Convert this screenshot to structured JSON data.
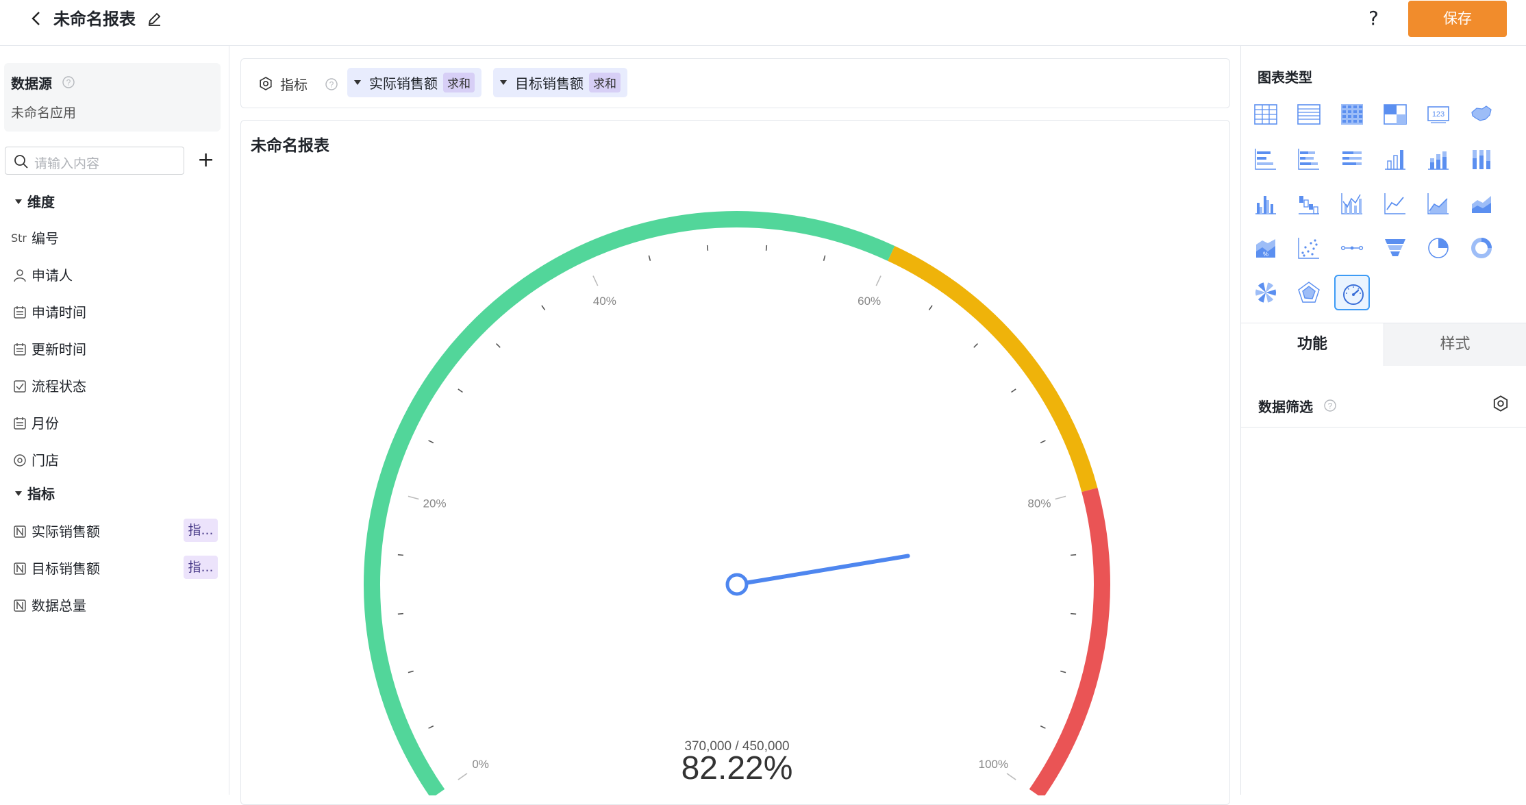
{
  "header": {
    "title": "未命名报表",
    "help": "?",
    "save_label": "保存"
  },
  "sidebar": {
    "datasource_title": "数据源",
    "datasource_name": "未命名应用",
    "search_placeholder": "请输入内容",
    "add": "+",
    "dimension_group": "维度",
    "dimensions": [
      {
        "icon": "Str",
        "label": "编号"
      },
      {
        "icon": "person-icon",
        "label": "申请人"
      },
      {
        "icon": "calendar-icon",
        "label": "申请时间"
      },
      {
        "icon": "calendar-icon",
        "label": "更新时间"
      },
      {
        "icon": "checkbox-icon",
        "label": "流程状态"
      },
      {
        "icon": "calendar-icon",
        "label": "月份"
      },
      {
        "icon": "target-icon",
        "label": "门店"
      }
    ],
    "metric_group": "指标",
    "metrics": [
      {
        "label": "实际销售额",
        "tag": "指..."
      },
      {
        "label": "目标销售额",
        "tag": "指..."
      },
      {
        "label": "数据总量",
        "tag": ""
      }
    ]
  },
  "toolbar": {
    "label": "指标",
    "pills": [
      {
        "label": "实际销售额",
        "agg": "求和"
      },
      {
        "label": "目标销售额",
        "agg": "求和"
      }
    ]
  },
  "chart": {
    "title": "未命名报表"
  },
  "chart_data": {
    "type": "gauge",
    "value": 370000,
    "target": 450000,
    "ratio_text": "370,000 / 450,000",
    "percent_text": "82.22%",
    "percent": 82.22,
    "tick_labels": [
      "0%",
      "20%",
      "40%",
      "60%",
      "80%",
      "100%"
    ],
    "bands": [
      {
        "from": 0,
        "to": 0.6,
        "color": "#52d69a"
      },
      {
        "from": 0.6,
        "to": 0.8,
        "color": "#efb30a"
      },
      {
        "from": 0.8,
        "to": 1.0,
        "color": "#ea5455"
      }
    ],
    "pointer_color": "#4e86ef"
  },
  "right": {
    "chart_types_title": "图表类型",
    "tab_function": "功能",
    "tab_style": "样式",
    "filter_label": "数据筛选",
    "chart_type_icons": [
      "table-icon",
      "list-table-icon",
      "grid-table-icon",
      "pivot-table-icon",
      "number-card-icon",
      "map-icon",
      "bar-horizontal-icon",
      "stacked-bar-horizontal-icon",
      "percent-bar-horizontal-icon",
      "column-icon",
      "stacked-column-icon",
      "percent-column-icon",
      "grouped-column-icon",
      "waterfall-icon",
      "column-line-icon",
      "line-icon",
      "area-line-icon",
      "stacked-area-icon",
      "percent-area-icon",
      "scatter-icon",
      "dot-line-icon",
      "funnel-icon",
      "pie-icon",
      "donut-icon",
      "rose-icon",
      "radar-icon",
      "gauge-icon"
    ],
    "selected": "gauge-icon"
  }
}
